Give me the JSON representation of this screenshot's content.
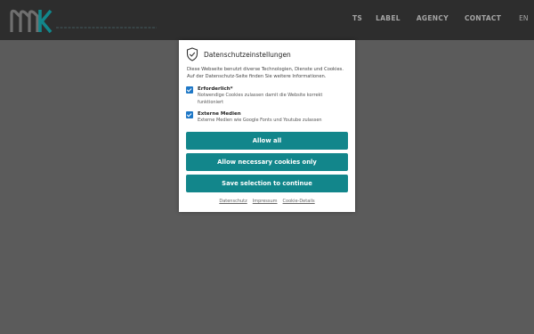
{
  "header": {
    "nav": {
      "partial_item": "TS",
      "items": [
        "LABEL",
        "AGENCY",
        "CONTACT"
      ],
      "language": "EN"
    },
    "brand_colors": {
      "primary": "#12868b",
      "logo_gray": "#707070"
    }
  },
  "cookie_dialog": {
    "title": "Datenschutzeinstellungen",
    "intro": "Diese Webseite benutzt diverse Technologien, Dienste und Cookies. Auf der Datenschutz-Seite finden Sie weitere Informationen.",
    "options": [
      {
        "title": "Erforderlich*",
        "description": "Notwendige Cookies zulassen damit die Website korrekt funktioniert",
        "checked": true
      },
      {
        "title": "Externe Medien",
        "description": "Externe Medien wie Google Fonts und Youtube zulassen",
        "checked": true
      }
    ],
    "buttons": {
      "allow_all": "Allow all",
      "allow_necessary": "Allow necessary cookies only",
      "save_selection": "Save selection to continue"
    },
    "links": {
      "privacy": "Datenschutz",
      "imprint": "Impressum",
      "cookie_details": "Cookie-Details"
    }
  }
}
